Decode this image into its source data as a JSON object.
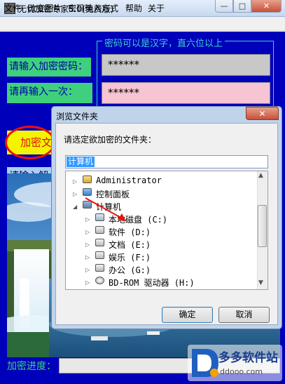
{
  "window": {
    "title": "无忧加密专家5.0(免费版)",
    "min_glyph": "—",
    "max_glyph": "□",
    "close_glyph": "✕"
  },
  "menu": [
    "文件",
    "改变图片",
    "密码输入方式",
    "帮助",
    "关于"
  ],
  "form": {
    "group_caption": "密码可以是汉字，直六位以上",
    "password_label": "请输入加密密码：",
    "confirm_label": "请再输入一次：",
    "password_value": "******",
    "confirm_value": "******",
    "encrypt_button": "加密文",
    "decrypt_label": "请输入解",
    "progress_label": "加密进度："
  },
  "dialog": {
    "title": "浏览文件夹",
    "close_glyph": "✕",
    "prompt": "请选定欲加密的文件夹：",
    "path_value": "计算机",
    "tree": [
      {
        "label": "Administrator",
        "icon": "user-folder-icon",
        "arrow": "▷"
      },
      {
        "label": "控制面板",
        "icon": "control-panel-icon",
        "arrow": "▷"
      },
      {
        "label": "计算机",
        "icon": "computer-icon",
        "arrow": "◢"
      },
      {
        "label": "本地磁盘 (C:)",
        "icon": "local-disk-icon",
        "arrow": "▷"
      },
      {
        "label": "软件 (D:)",
        "icon": "drive-icon",
        "arrow": "▷"
      },
      {
        "label": "文档 (E:)",
        "icon": "drive-icon",
        "arrow": "▷"
      },
      {
        "label": "娱乐 (F:)",
        "icon": "drive-icon",
        "arrow": "▷"
      },
      {
        "label": "办公 (G:)",
        "icon": "drive-icon",
        "arrow": "▷"
      },
      {
        "label": "BD-ROM 驱动器 (H:)",
        "icon": "cd-drive-icon",
        "arrow": "▷"
      }
    ],
    "ok_button": "确定",
    "cancel_button": "取消"
  },
  "watermark": {
    "title": "多多软件站",
    "url": "ddooo.com"
  },
  "colors": {
    "client_bg": "#0000bb",
    "label_green": "#3fd07d",
    "caption_cyan": "#3fd0d0",
    "encrypt_yellow": "#f4f400",
    "annotation_red": "#ee1010"
  }
}
